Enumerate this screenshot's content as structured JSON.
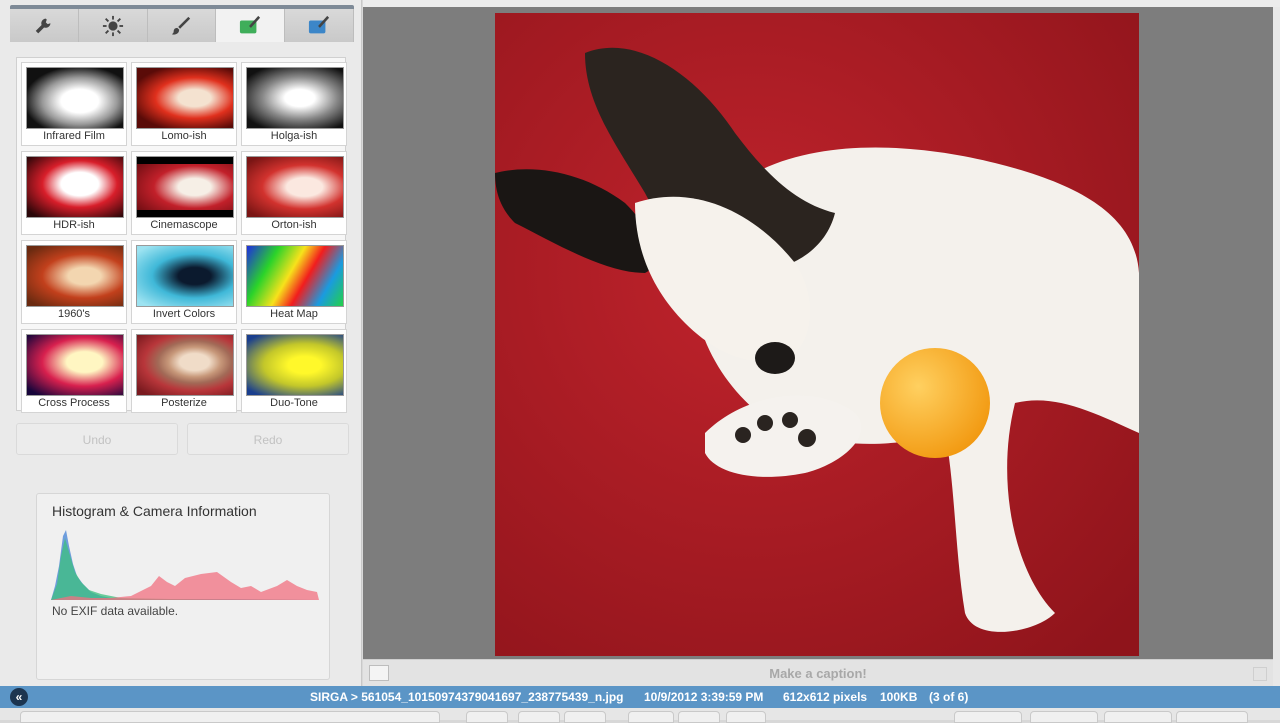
{
  "tabs": [
    {
      "name": "wrench-icon",
      "active": false
    },
    {
      "name": "brightness-icon",
      "active": false
    },
    {
      "name": "brush-icon",
      "active": false
    },
    {
      "name": "effects-green-icon",
      "active": true
    },
    {
      "name": "effects-blue-icon",
      "active": false
    }
  ],
  "effects": [
    {
      "label": "Infrared Film"
    },
    {
      "label": "Lomo-ish"
    },
    {
      "label": "Holga-ish"
    },
    {
      "label": "HDR-ish"
    },
    {
      "label": "Cinemascope"
    },
    {
      "label": "Orton-ish"
    },
    {
      "label": "1960's"
    },
    {
      "label": "Invert Colors"
    },
    {
      "label": "Heat Map"
    },
    {
      "label": "Cross Process"
    },
    {
      "label": "Posterize"
    },
    {
      "label": "Duo-Tone"
    }
  ],
  "actions": {
    "undo": "Undo",
    "redo": "Redo"
  },
  "histogram": {
    "title": "Histogram & Camera Information",
    "note": "No EXIF data available."
  },
  "caption": {
    "placeholder": "Make a caption!"
  },
  "status": {
    "path": "SIRGA > 561054_10150974379041697_238775439_n.jpg",
    "date": "10/9/2012 3:39:59 PM",
    "dimensions": "612x612 pixels",
    "size": "100KB",
    "position": "(3 of 6)"
  },
  "colors": {
    "accent": "#5b95c6",
    "photo_bg": "#b5202a"
  }
}
